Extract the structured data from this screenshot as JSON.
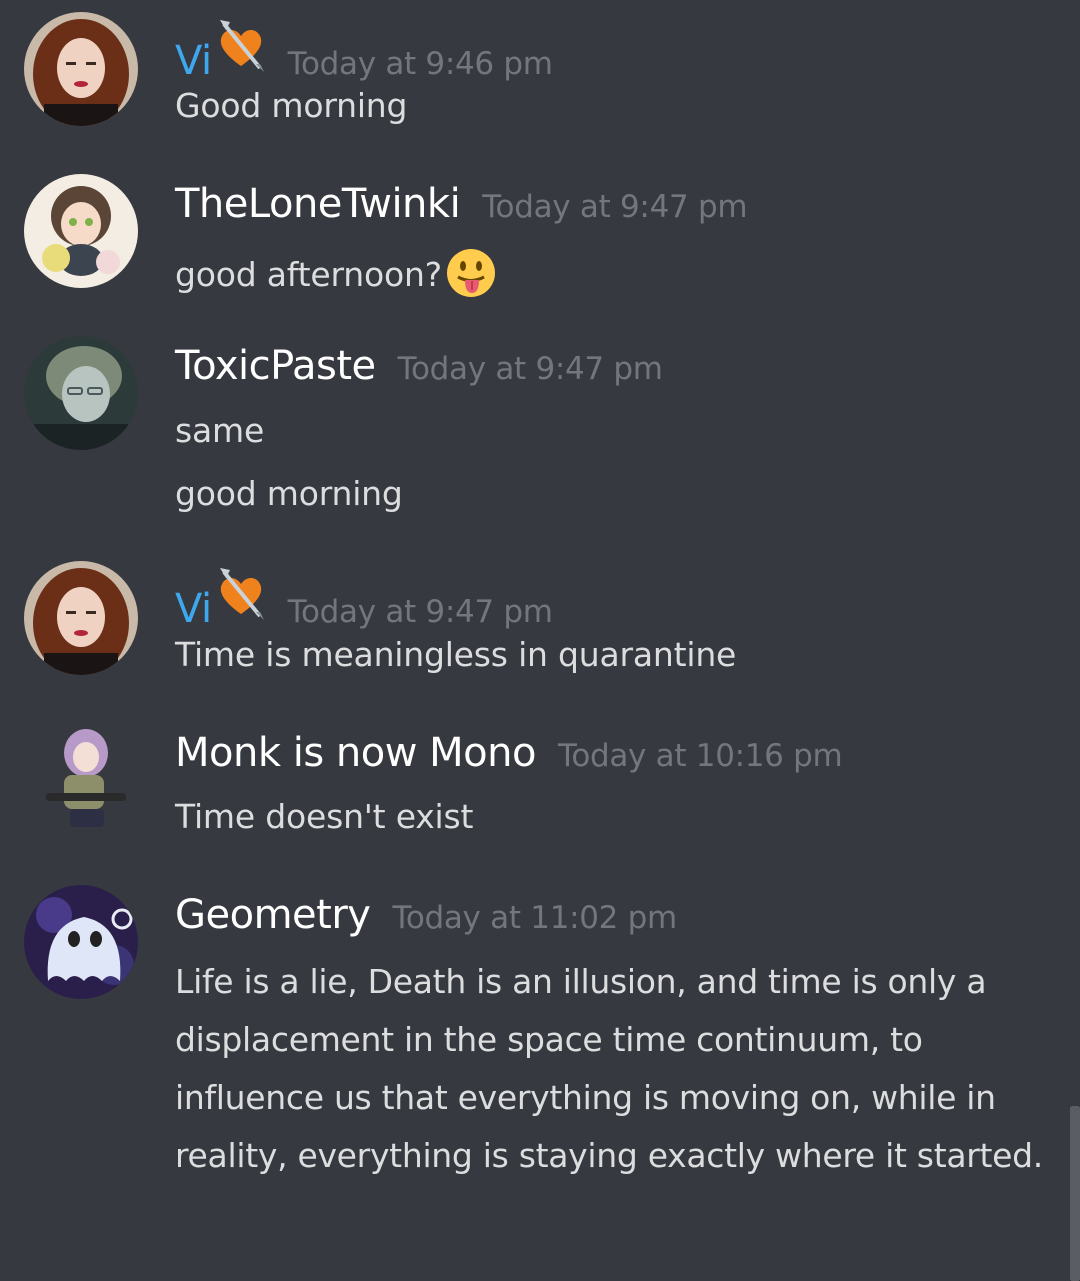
{
  "messages": [
    {
      "author": "Vi",
      "author_color": "#3ea8ee",
      "badge_icon": "heart-arrow-icon",
      "timestamp": "Today at 9:46 pm",
      "lines": [
        "Good morning"
      ]
    },
    {
      "author": "TheLoneTwinki",
      "author_color": "#ffffff",
      "timestamp": "Today at 9:47 pm",
      "lines": [
        "good afternoon?"
      ],
      "emoji_icon": "tongue-out-emoji-icon"
    },
    {
      "author": "ToxicPaste",
      "author_color": "#ffffff",
      "timestamp": "Today at 9:47 pm",
      "lines": [
        "same",
        "good morning"
      ]
    },
    {
      "author": "Vi",
      "author_color": "#3ea8ee",
      "badge_icon": "heart-arrow-icon",
      "timestamp": "Today at 9:47 pm",
      "lines": [
        "Time is meaningless in quarantine"
      ]
    },
    {
      "author": "Monk is now Mono",
      "author_color": "#ffffff",
      "timestamp": "Today at 10:16 pm",
      "lines": [
        "Time doesn't exist"
      ]
    },
    {
      "author": "Geometry",
      "author_color": "#ffffff",
      "timestamp": "Today at 11:02 pm",
      "lines": [
        "Life is a lie, Death is an illusion, and time is only a displacement in the space time continuum, to influence us that everything is moving on, while in reality, everything is staying exactly where it started."
      ]
    }
  ],
  "colors": {
    "background": "#36393f",
    "message_text": "#dcddde",
    "timestamp_text": "#72767d"
  }
}
